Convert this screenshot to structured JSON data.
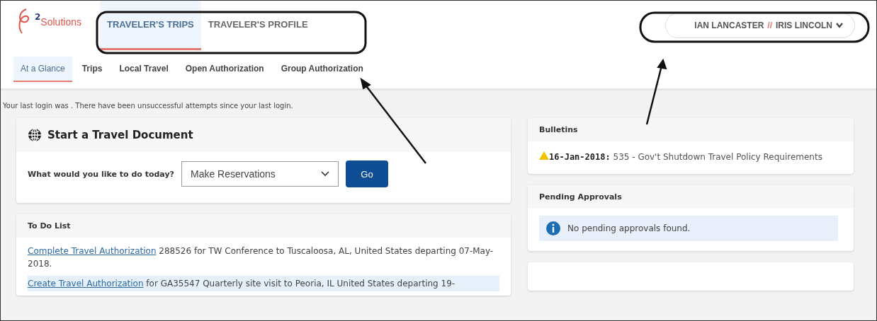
{
  "logo": {
    "superscript": "2",
    "text": "Solutions"
  },
  "main_tabs": [
    {
      "label": "TRAVELER'S TRIPS",
      "selected": true
    },
    {
      "label": "TRAVELER'S PROFILE",
      "selected": false
    }
  ],
  "user_menu": {
    "traveler": "IAN LANCASTER",
    "separator": "//",
    "delegate": "IRIS LINCOLN"
  },
  "sub_tabs": [
    {
      "label": "At a Glance",
      "selected": true
    },
    {
      "label": "Trips",
      "selected": false
    },
    {
      "label": "Local Travel",
      "selected": false
    },
    {
      "label": "Open Authorization",
      "selected": false
    },
    {
      "label": "Group Authorization",
      "selected": false
    }
  ],
  "login_notice": "Your last login was . There have been unsuccessful attempts since your last login.",
  "start_card": {
    "title": "Start a Travel Document",
    "prompt": "What would you like to do today?",
    "select_value": "Make Reservations",
    "button": "Go"
  },
  "todo": {
    "title": "To Do List",
    "items": [
      {
        "link": "Complete Travel Authorization",
        "text": " 288526 for TW Conference to Tuscaloosa, AL, United States departing 07-May-2018.",
        "highlighted": false
      },
      {
        "link": "Create Travel Authorization",
        "text": " for GA35547 Quarterly site visit to Peoria, IL United States departing 19-",
        "highlighted": true
      }
    ]
  },
  "bulletins": {
    "title": "Bulletins",
    "items": [
      {
        "date": "16-Jan-2018:",
        "text": "535 - Gov't Shutdown Travel Policy Requirements"
      }
    ]
  },
  "pending": {
    "title": "Pending Approvals",
    "message": "No pending approvals found."
  }
}
